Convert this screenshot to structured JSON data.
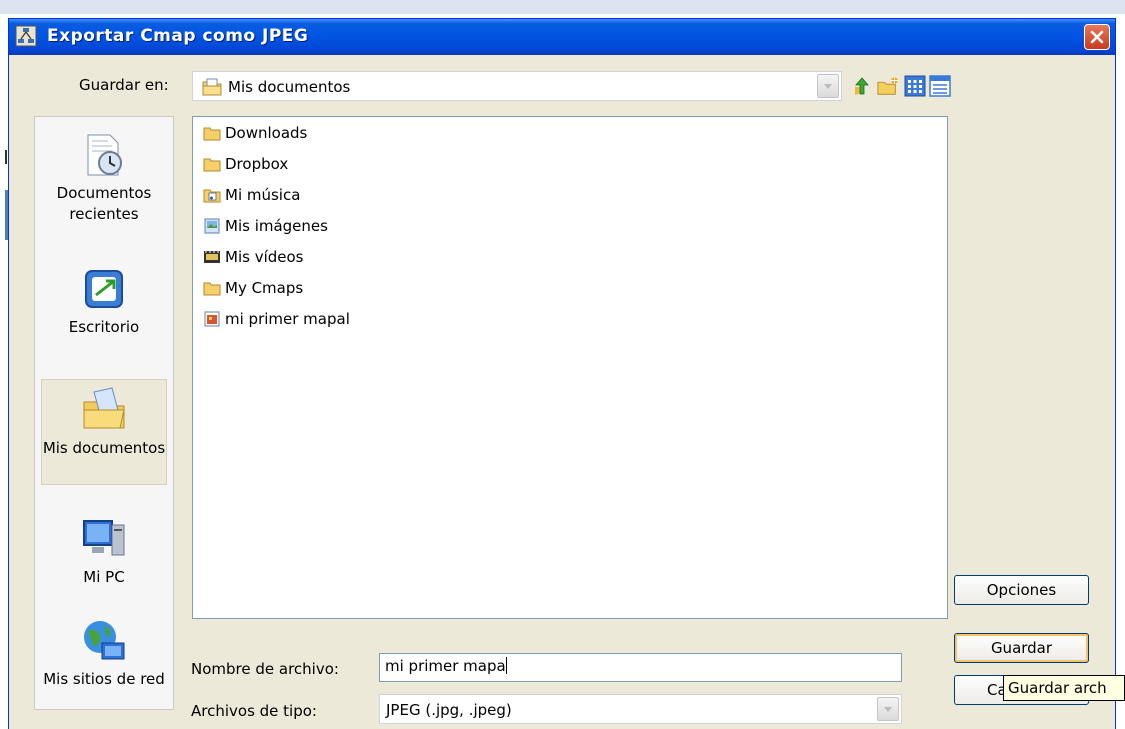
{
  "window": {
    "title": "Exportar Cmap como JPEG"
  },
  "location": {
    "label": "Guardar en:",
    "current": "Mis documentos"
  },
  "toolbar": {
    "icons": [
      "up-one-level-icon",
      "new-folder-icon",
      "list-view-icon",
      "details-view-icon"
    ]
  },
  "places": [
    {
      "label": "Documentos recientes",
      "icon": "recent-documents-icon"
    },
    {
      "label": "Escritorio",
      "icon": "desktop-icon"
    },
    {
      "label": "Mis documentos",
      "icon": "my-documents-icon",
      "selected": true
    },
    {
      "label": "Mi PC",
      "icon": "my-computer-icon"
    },
    {
      "label": "Mis sitios de red",
      "icon": "network-places-icon"
    }
  ],
  "files": [
    {
      "name": "Downloads",
      "icon": "folder-icon"
    },
    {
      "name": "Dropbox",
      "icon": "folder-icon"
    },
    {
      "name": "Mi música",
      "icon": "music-folder-icon"
    },
    {
      "name": "Mis imágenes",
      "icon": "pictures-folder-icon"
    },
    {
      "name": "Mis vídeos",
      "icon": "videos-folder-icon"
    },
    {
      "name": "My Cmaps",
      "icon": "folder-icon"
    },
    {
      "name": "mi primer mapal",
      "icon": "cmap-file-icon"
    }
  ],
  "form": {
    "filename_label": "Nombre de archivo:",
    "filename_value": "mi primer mapa",
    "filetype_label": "Archivos de tipo:",
    "filetype_value": "JPEG (.jpg, .jpeg)"
  },
  "buttons": {
    "options": "Opciones",
    "save": "Guardar",
    "cancel_visible": "Ca"
  },
  "tooltip": "Guardar arch"
}
